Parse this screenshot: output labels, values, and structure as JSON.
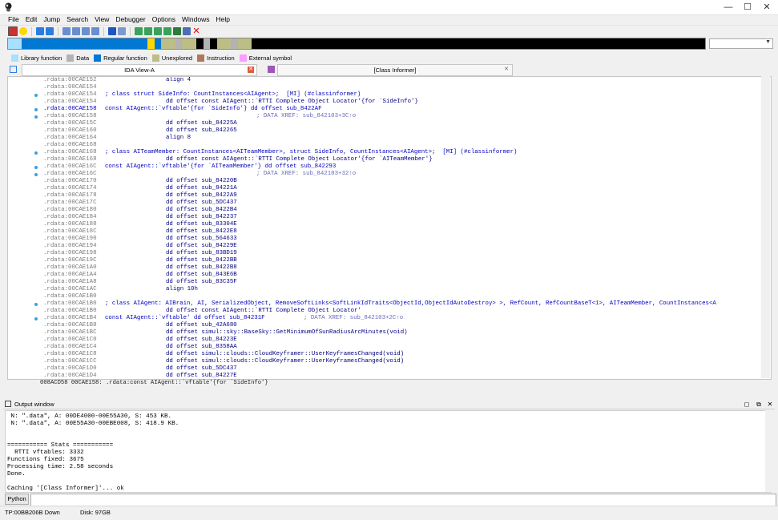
{
  "window": {
    "minimize": "—",
    "maximize": "☐",
    "close": "✕"
  },
  "menu": [
    "File",
    "Edit",
    "Jump",
    "Search",
    "View",
    "Debugger",
    "Options",
    "Windows",
    "Help"
  ],
  "legend": [
    {
      "label": "Library function",
      "color": "#a8e0ff"
    },
    {
      "label": "Data",
      "color": "#b3b3b3"
    },
    {
      "label": "Regular function",
      "color": "#0078d4"
    },
    {
      "label": "Unexplored",
      "color": "#bdbd86"
    },
    {
      "label": "Instruction",
      "color": "#b07a5a"
    },
    {
      "label": "External symbol",
      "color": "#ff9cff"
    }
  ],
  "tabs": {
    "ida_view": "IDA View-A",
    "ida_view_close": "✕",
    "class_informer": "[Class Informer]",
    "class_informer_close": "✕"
  },
  "code_lines": [
    {
      "addr": ".rdata:00CAE152",
      "ins": "align 4"
    },
    {
      "addr": ".rdata:00CAE154",
      "ins": ""
    },
    {
      "addr": ".rdata:00CAE154",
      "comment": "; class struct SideInfo: CountInstances<AIAgent>;  [MI] (#classinformer)"
    },
    {
      "addr": ".rdata:00CAE154",
      "ins": "dd offset const AIAgent::`RTTI Complete Object Locator'{for `SideInfo'}"
    },
    {
      "addr": ".rdata:00CAE158",
      "hl": true,
      "comment": "const AIAgent::`vftable'{for `SideInfo'} dd offset sub_8422AF"
    },
    {
      "addr": ".rdata:00CAE158",
      "xref": "; DATA XREF: sub_842103+3C↑o"
    },
    {
      "addr": ".rdata:00CAE15C",
      "ins": "dd offset sub_84225A"
    },
    {
      "addr": ".rdata:00CAE160",
      "ins": "dd offset sub_842265"
    },
    {
      "addr": ".rdata:00CAE164",
      "ins": "align 8"
    },
    {
      "addr": ".rdata:00CAE168",
      "ins": ""
    },
    {
      "addr": ".rdata:00CAE168",
      "comment": "; class AITeamMember: CountInstances<AITeamMember>, struct SideInfo, CountInstances<AIAgent>;  [MI] (#classinformer)"
    },
    {
      "addr": ".rdata:00CAE168",
      "ins": "dd offset const AIAgent::`RTTI Complete Object Locator'{for `AITeamMember'}"
    },
    {
      "addr": ".rdata:00CAE16C",
      "comment": "const AIAgent::`vftable'{for `AITeamMember'} dd offset sub_842293"
    },
    {
      "addr": ".rdata:00CAE16C",
      "xref": "; DATA XREF: sub_842103+32↑o"
    },
    {
      "addr": ".rdata:00CAE170",
      "ins": "dd offset sub_84220B"
    },
    {
      "addr": ".rdata:00CAE174",
      "ins": "dd offset sub_84221A"
    },
    {
      "addr": ".rdata:00CAE178",
      "ins": "dd offset sub_8422A9"
    },
    {
      "addr": ".rdata:00CAE17C",
      "ins": "dd offset sub_5DC437"
    },
    {
      "addr": ".rdata:00CAE180",
      "ins": "dd offset sub_8422B4"
    },
    {
      "addr": ".rdata:00CAE184",
      "ins": "dd offset sub_842237"
    },
    {
      "addr": ".rdata:00CAE188",
      "ins": "dd offset sub_83304E"
    },
    {
      "addr": ".rdata:00CAE18C",
      "ins": "dd offset sub_8422E8"
    },
    {
      "addr": ".rdata:00CAE190",
      "ins": "dd offset sub_564633"
    },
    {
      "addr": ".rdata:00CAE194",
      "ins": "dd offset sub_84229E"
    },
    {
      "addr": ".rdata:00CAE198",
      "ins": "dd offset sub_83BD19"
    },
    {
      "addr": ".rdata:00CAE19C",
      "ins": "dd offset sub_8422BB"
    },
    {
      "addr": ".rdata:00CAE1A0",
      "ins": "dd offset sub_8422B8"
    },
    {
      "addr": ".rdata:00CAE1A4",
      "ins": "dd offset sub_843E6B"
    },
    {
      "addr": ".rdata:00CAE1A8",
      "ins": "dd offset sub_83C35F"
    },
    {
      "addr": ".rdata:00CAE1AC",
      "ins": "align 10h"
    },
    {
      "addr": ".rdata:00CAE1B0",
      "ins": ""
    },
    {
      "addr": ".rdata:00CAE1B0",
      "comment": "; class AIAgent: AIBrain, AI, SerializedObject, RemoveSoftLinks<SoftLinkIdTraits<ObjectId,ObjectIdAutoDestroy> >, RefCount, RefCountBaseT<1>, AITeamMember, CountInstances<A"
    },
    {
      "addr": ".rdata:00CAE1B0",
      "ins": "dd offset const AIAgent::`RTTI Complete Object Locator'"
    },
    {
      "addr": ".rdata:00CAE1B4",
      "comment": "const AIAgent::`vftable' dd offset sub_84231F",
      "xref2": "; DATA XREF: sub_842103+2C↑o"
    },
    {
      "addr": ".rdata:00CAE1B8",
      "ins": "dd offset sub_42A680"
    },
    {
      "addr": ".rdata:00CAE1BC",
      "ins": "dd offset simul::sky::BaseSky::GetMinimumOfSunRadiusArcMinutes(void)"
    },
    {
      "addr": ".rdata:00CAE1C0",
      "ins": "dd offset sub_84223E"
    },
    {
      "addr": ".rdata:00CAE1C4",
      "ins": "dd offset sub_8358AA"
    },
    {
      "addr": ".rdata:00CAE1C8",
      "ins": "dd offset simul::clouds::CloudKeyframer::UserKeyframesChanged(void)"
    },
    {
      "addr": ".rdata:00CAE1CC",
      "ins": "dd offset simul::clouds::CloudKeyframer::UserKeyframesChanged(void)"
    },
    {
      "addr": ".rdata:00CAE1D0",
      "ins": "dd offset sub_5DC437"
    },
    {
      "addr": ".rdata:00CAE1D4",
      "ins": "dd offset sub_84227E"
    }
  ],
  "status_line": "008ACD58 00CAE158: .rdata:const AIAgent::`vftable'{for `SideInfo'}",
  "output": {
    "title": "Output window",
    "lines": [
      " N: \".data\", A: 00DE4000-00E55A30, S: 453 KB.",
      " N: \".data\", A: 00E55A30-00EBE008, S: 418.9 KB.",
      "",
      "",
      "=========== Stats ===========",
      "  RTTI vftables: 3332",
      "Functions fixed: 3675",
      "Processing time: 2.58 seconds",
      "Done.",
      "",
      "Caching '[Class Informer]'... ok"
    ]
  },
  "command": {
    "button": "Python",
    "value": ""
  },
  "statusbar": {
    "left": "TP:00BB206B Down",
    "disk": "Disk: 97GB"
  }
}
